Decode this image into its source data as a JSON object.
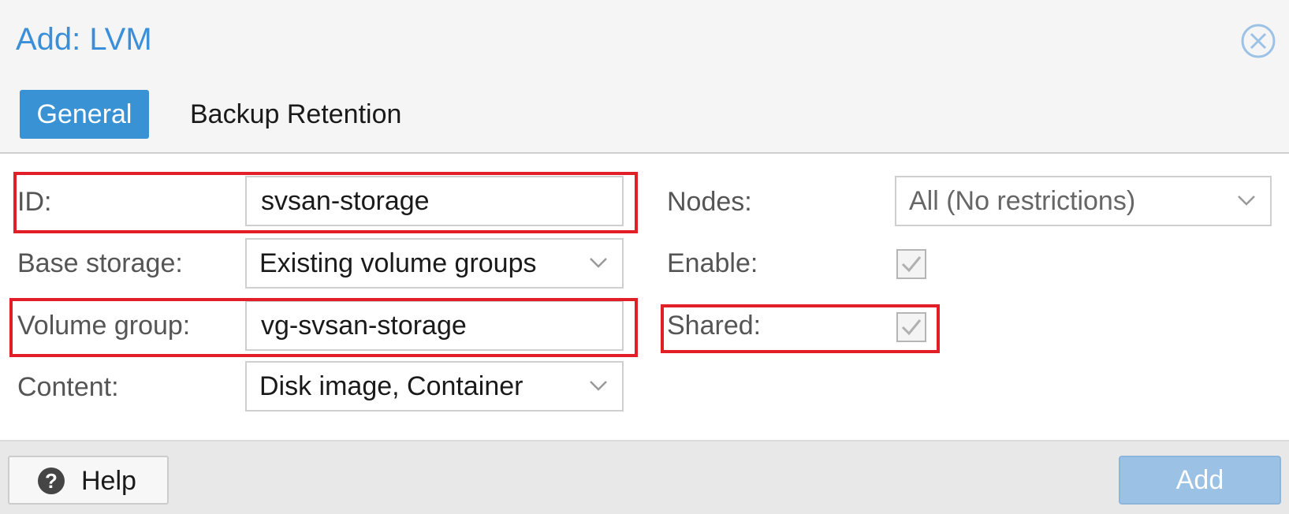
{
  "dialog": {
    "title": "Add: LVM"
  },
  "tabs": [
    {
      "label": "General",
      "active": true
    },
    {
      "label": "Backup Retention",
      "active": false
    }
  ],
  "form": {
    "id": {
      "label": "ID:",
      "value": "svsan-storage"
    },
    "base_storage": {
      "label": "Base storage:",
      "value": "Existing volume groups"
    },
    "volume_group": {
      "label": "Volume group:",
      "value": "vg-svsan-storage"
    },
    "content": {
      "label": "Content:",
      "value": "Disk image, Container"
    },
    "nodes": {
      "label": "Nodes:",
      "value": "All (No restrictions)"
    },
    "enable": {
      "label": "Enable:",
      "checked": true
    },
    "shared": {
      "label": "Shared:",
      "checked": true
    }
  },
  "footer": {
    "help_label": "Help",
    "help_icon_glyph": "?",
    "add_label": "Add"
  },
  "colors": {
    "accent": "#3892d4",
    "title": "#3a8fd8",
    "highlight": "#e21f26",
    "add_disabled": "#9bc1e4"
  },
  "icons": {
    "close": "close-circle-icon",
    "dropdown": "chevron-down-icon",
    "check": "checkmark-icon",
    "help": "question-circle-icon"
  }
}
